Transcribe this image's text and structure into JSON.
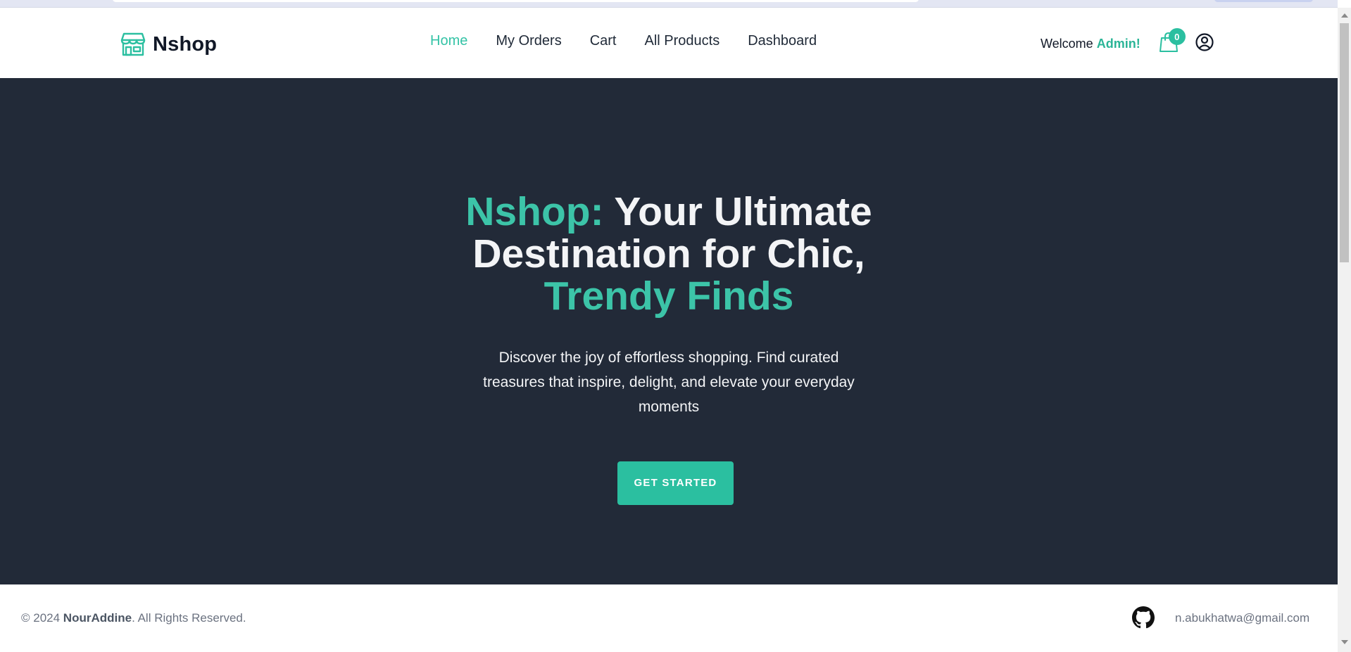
{
  "brand": {
    "name": "Nshop",
    "icon": "store-icon"
  },
  "nav": {
    "items": [
      {
        "label": "Home",
        "active": true
      },
      {
        "label": "My Orders",
        "active": false
      },
      {
        "label": "Cart",
        "active": false
      },
      {
        "label": "All Products",
        "active": false
      },
      {
        "label": "Dashboard",
        "active": false
      }
    ]
  },
  "user": {
    "welcome_prefix": "Welcome ",
    "name": "Admin!",
    "cart_count": "0",
    "cart_icon": "shopping-bag-icon",
    "profile_icon": "user-circle-icon"
  },
  "hero": {
    "title_accent_1": "Nshop:",
    "title_main": " Your Ultimate Destination for Chic,",
    "title_accent_2": "Trendy Finds",
    "subtitle": "Discover the joy of effortless shopping. Find curated treasures that inspire, delight, and elevate your everyday moments",
    "cta_label": "GET STARTED"
  },
  "footer": {
    "copyright_prefix": "© 2024 ",
    "owner": "NourAddine",
    "copyright_suffix": ". All Rights Reserved.",
    "github_icon": "github-icon",
    "email": "n.abukhatwa@gmail.com"
  },
  "colors": {
    "accent": "#2bbfa0",
    "hero_background": "#222a38",
    "text_light": "#f3f4f6",
    "text_dark": "#111827"
  }
}
